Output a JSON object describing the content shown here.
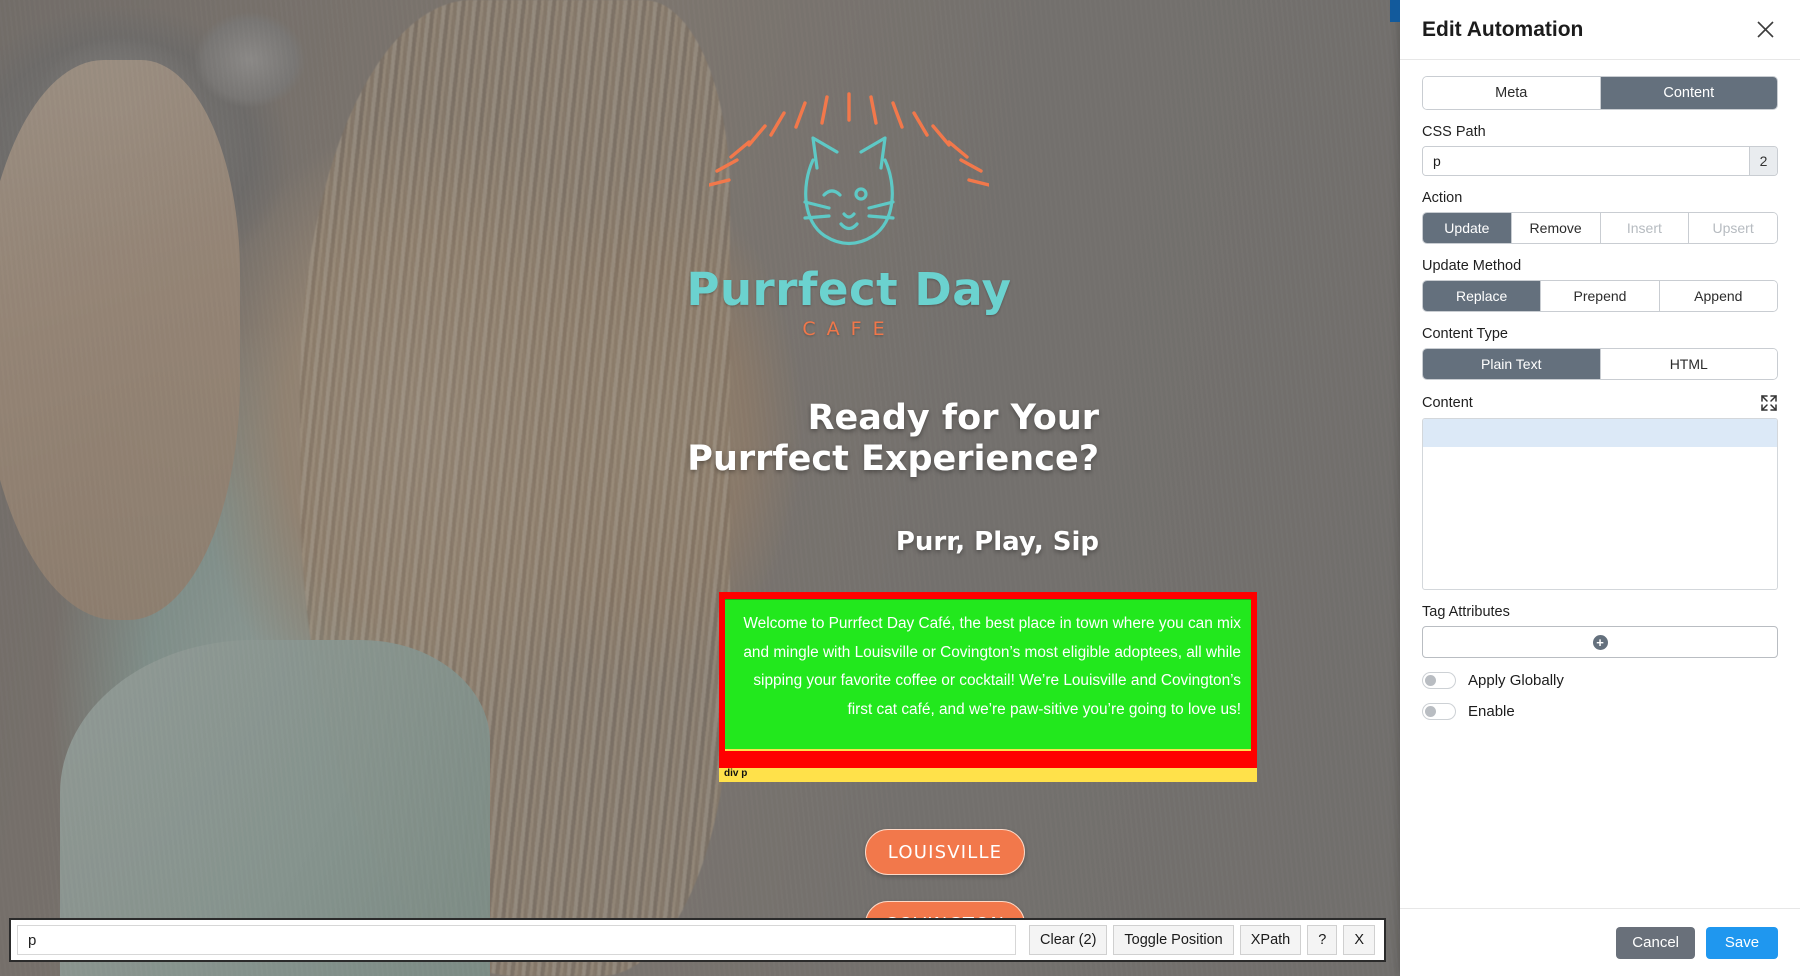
{
  "webpage": {
    "logo": {
      "name": "Purrfect Day",
      "subtitle": "CAFE",
      "icon": "cat-face-sunburst-logo"
    },
    "hero": {
      "heading": "Ready for Your Purrfect Experience?",
      "subheading": "Purr, Play, Sip"
    },
    "selected_element": {
      "tag_label": "div p",
      "text": "Welcome to Purrfect Day Café, the best place in town where you can mix and mingle with Louisville or Covington’s most eligible adoptees, all while sipping your favorite coffee or cocktail! We’re Louisville and Covington’s first cat café, and we’re paw-sitive you’re going to love us!",
      "highlight_color": "#22e81d",
      "outline_color": "#ff0000",
      "tag_bar_color": "#ffe14a"
    },
    "cta_buttons": [
      {
        "label": "LOUISVILLE"
      },
      {
        "label": "COVINGTON"
      }
    ],
    "cta_color": "#f2784b"
  },
  "selector_bar": {
    "selector_value": "p",
    "selector_placeholder": "",
    "buttons": [
      {
        "label": "Clear (2)",
        "name": "clear-button"
      },
      {
        "label": "Toggle Position",
        "name": "toggle-position-button"
      },
      {
        "label": "XPath",
        "name": "xpath-button"
      },
      {
        "label": "?",
        "name": "help-button"
      },
      {
        "label": "X",
        "name": "close-button"
      }
    ]
  },
  "panel": {
    "title": "Edit Automation",
    "close_icon": "close-icon",
    "handle_color": "#125a9c",
    "tabs": [
      {
        "label": "Meta",
        "active": false
      },
      {
        "label": "Content",
        "active": true
      }
    ],
    "css_path": {
      "label": "CSS Path",
      "value": "p",
      "placeholder": "",
      "match_count": "2"
    },
    "action": {
      "label": "Action",
      "options": [
        {
          "label": "Update",
          "state": "on"
        },
        {
          "label": "Remove",
          "state": "off"
        },
        {
          "label": "Insert",
          "state": "disabled"
        },
        {
          "label": "Upsert",
          "state": "disabled"
        }
      ]
    },
    "update_method": {
      "label": "Update Method",
      "options": [
        {
          "label": "Replace",
          "state": "on"
        },
        {
          "label": "Prepend",
          "state": "off"
        },
        {
          "label": "Append",
          "state": "off"
        }
      ]
    },
    "content_type": {
      "label": "Content Type",
      "options": [
        {
          "label": "Plain Text",
          "state": "on"
        },
        {
          "label": "HTML",
          "state": "off"
        }
      ]
    },
    "content": {
      "label": "Content",
      "expand_icon": "expand-icon",
      "value": "",
      "placeholder": ""
    },
    "tag_attributes": {
      "label": "Tag Attributes",
      "add_icon": "plus-icon"
    },
    "toggles": [
      {
        "label": "Apply Globally",
        "on": false
      },
      {
        "label": "Enable",
        "on": false
      }
    ],
    "footer": {
      "cancel_label": "Cancel",
      "save_label": "Save",
      "cancel_color": "#69707a",
      "save_color": "#1f97ef"
    }
  }
}
